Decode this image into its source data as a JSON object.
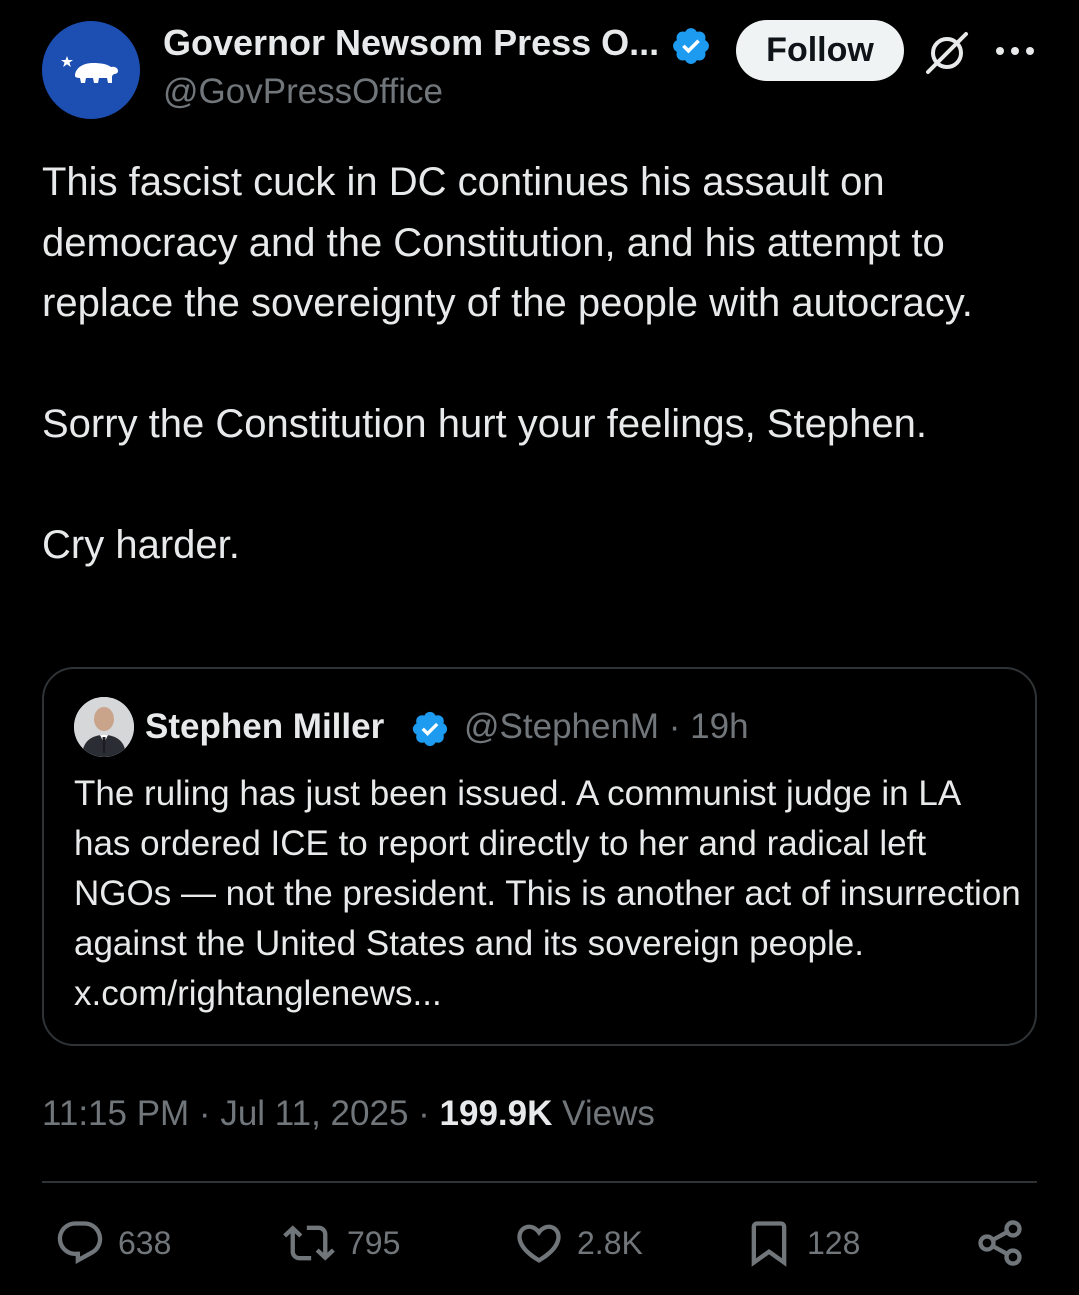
{
  "author": {
    "name": "Governor Newsom Press O...",
    "handle": "@GovPressOffice",
    "avatar_icon": "california-bear-icon",
    "avatar_color": "#1d4fb3"
  },
  "follow_label": "Follow",
  "tweet_text": "This fascist cuck in DC continues his assault on democracy and the Constitution, and his attempt to replace the sovereignty of the people with autocracy.\n\nSorry the Constitution hurt your feelings, Stephen.\n\nCry harder.",
  "quote": {
    "name": "Stephen Miller",
    "handle_time": "@StephenM · 19h",
    "text": "The ruling has just been issued. A communist judge in LA has ordered ICE to report directly to her and radical left NGOs — not the president. This is another act of insurrection against the United States and its sovereign people. x.com/rightanglenews..."
  },
  "meta": {
    "time_date": "11:15 PM · Jul 11, 2025 · ",
    "views_count": "199.9K",
    "views_label": " Views"
  },
  "actions": {
    "replies": "638",
    "reposts": "795",
    "likes": "2.8K",
    "bookmarks": "128"
  },
  "colors": {
    "background": "#000000",
    "text": "#e7e9ea",
    "muted": "#71767b",
    "verified": "#1d9bf0"
  }
}
